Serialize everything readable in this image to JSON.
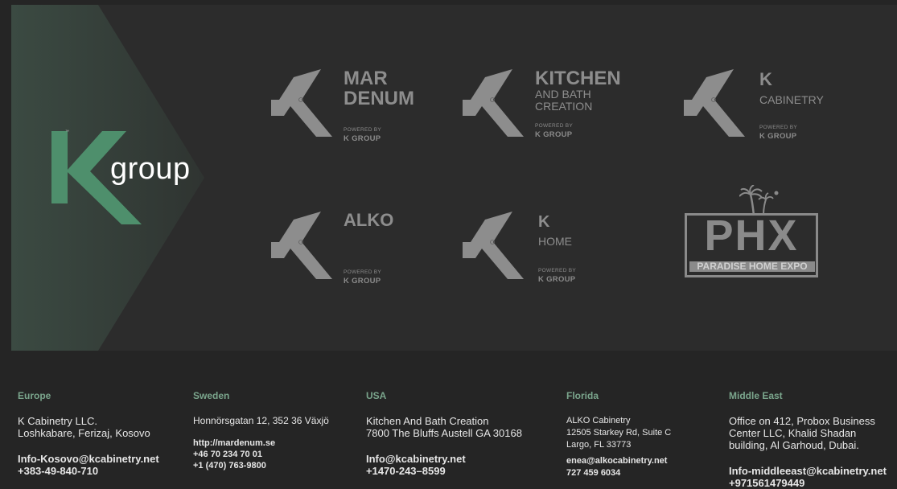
{
  "colors": {
    "accent": "#4e8f6c",
    "logo_gray": "#8d8d8d",
    "region": "#7aa58c"
  },
  "hero": {
    "logo": {
      "mark": "K",
      "text": "group",
      "trademark": "™"
    },
    "brands": [
      {
        "id": "mardenum",
        "name_lines": [
          "MAR",
          "DENUM"
        ],
        "sub_lines": [],
        "powered": "POWERED BY",
        "group": "K GROUP"
      },
      {
        "id": "kitchen",
        "name_lines": [
          "KITCHEN"
        ],
        "sub_lines": [
          "AND BATH",
          "CREATION"
        ],
        "powered": "POWERED BY",
        "group": "K GROUP"
      },
      {
        "id": "kcab",
        "name_lines": [
          "K"
        ],
        "sub_lines": [
          "CABINETRY"
        ],
        "powered": "POWERED BY",
        "group": "K GROUP"
      },
      {
        "id": "alko",
        "name_lines": [
          "ALKO"
        ],
        "sub_lines": [],
        "powered": "POWERED BY",
        "group": "K GROUP"
      },
      {
        "id": "khome",
        "name_lines": [
          "K"
        ],
        "sub_lines": [
          "HOME"
        ],
        "powered": "POWERED BY",
        "group": "K GROUP"
      }
    ],
    "phx": {
      "letters": "PHX",
      "tagline": "PARADISE HOME EXPO"
    }
  },
  "footer": {
    "columns": [
      {
        "region": "Europe",
        "address": [
          "K Cabinetry LLC.",
          "Loshkabare, Ferizaj, Kosovo"
        ],
        "contacts": [
          "Info-Kosovo@kcabinetry.net",
          "+383-49-840-710"
        ]
      },
      {
        "region": "Sweden",
        "address": [
          "Honnörsgatan 12, 352 36 Växjö"
        ],
        "contacts": [
          "http://mardenum.se",
          "+46 70 234 70 01",
          "+1 (470) 763-9800"
        ]
      },
      {
        "region": "USA",
        "address": [
          "Kitchen And Bath Creation",
          "7800 The Bluffs Austell GA 30168"
        ],
        "contacts": [
          "Info@kcabinetry.net",
          "+1470-243–8599"
        ]
      },
      {
        "region": "Florida",
        "address": [
          "ALKO Cabinetry",
          "12505 Starkey Rd, Suite C",
          "Largo, FL 33773"
        ],
        "contacts": [
          "enea@alkocabinetry.net",
          "727 459 6034"
        ]
      },
      {
        "region": "Middle East",
        "address": [
          "Office on 412, Probox Business",
          "Center LLC, Khalid Shadan",
          "building, Al Garhoud, Dubai."
        ],
        "contacts": [
          "Info-middleeast@kcabinetry.net",
          "+971561479449"
        ]
      }
    ]
  }
}
